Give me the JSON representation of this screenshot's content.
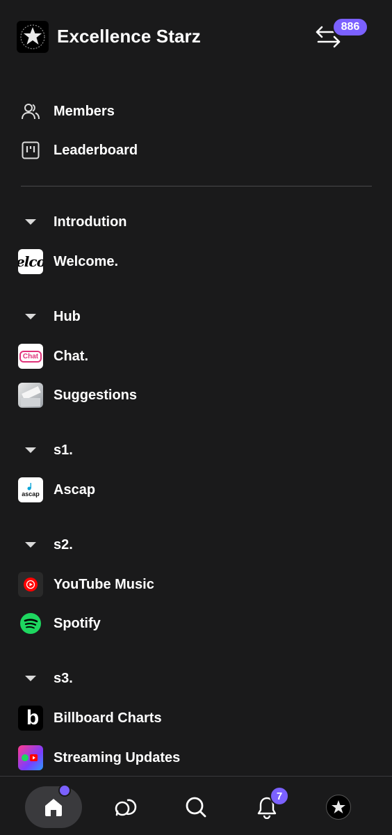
{
  "header": {
    "server_name": "Excellence Starz",
    "switch_badge": "886"
  },
  "nav": [
    {
      "label": "Members",
      "icon": "members-icon"
    },
    {
      "label": "Leaderboard",
      "icon": "leaderboard-icon"
    }
  ],
  "categories": [
    {
      "label": "Introdution",
      "channels": [
        {
          "label": "Welcome.",
          "icon": "welcome-icon"
        }
      ]
    },
    {
      "label": "Hub",
      "channels": [
        {
          "label": "Chat.",
          "icon": "chat-icon"
        },
        {
          "label": "Suggestions",
          "icon": "suggestions-icon"
        }
      ]
    },
    {
      "label": "s1.",
      "channels": [
        {
          "label": "Ascap",
          "icon": "ascap-icon"
        }
      ]
    },
    {
      "label": "s2.",
      "channels": [
        {
          "label": "YouTube Music",
          "icon": "youtube-music-icon"
        },
        {
          "label": "Spotify",
          "icon": "spotify-icon"
        }
      ]
    },
    {
      "label": "s3.",
      "channels": [
        {
          "label": "Billboard Charts",
          "icon": "billboard-icon"
        },
        {
          "label": "Streaming Updates",
          "icon": "streaming-updates-icon"
        }
      ]
    }
  ],
  "icon_text": {
    "welcome": "elco",
    "chat": "Chat",
    "ascap": "ascap",
    "billboard": "b"
  },
  "bottom_nav": {
    "notifications_badge": "7"
  },
  "colors": {
    "background": "#1a1a1b",
    "accent": "#7b61ff",
    "divider": "#4a4a4c"
  }
}
